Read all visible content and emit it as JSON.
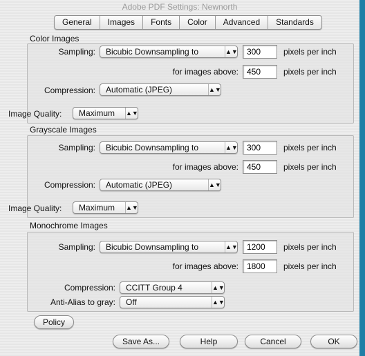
{
  "window": {
    "title": "Adobe PDF Settings: Newnorth"
  },
  "tabs": [
    "General",
    "Images",
    "Fonts",
    "Color",
    "Advanced",
    "Standards"
  ],
  "color": {
    "label": "Color Images",
    "sampling_label": "Sampling:",
    "sampling_value": "Bicubic Downsampling to",
    "resolution": "300",
    "resolution_unit": "pixels per inch",
    "above_label": "for images above:",
    "above_value": "450",
    "above_unit": "pixels per inch",
    "compression_label": "Compression:",
    "compression_value": "Automatic (JPEG)",
    "quality_label": "Image Quality:",
    "quality_value": "Maximum"
  },
  "grayscale": {
    "label": "Grayscale Images",
    "sampling_label": "Sampling:",
    "sampling_value": "Bicubic Downsampling to",
    "resolution": "300",
    "resolution_unit": "pixels per inch",
    "above_label": "for images above:",
    "above_value": "450",
    "above_unit": "pixels per inch",
    "compression_label": "Compression:",
    "compression_value": "Automatic (JPEG)",
    "quality_label": "Image Quality:",
    "quality_value": "Maximum"
  },
  "mono": {
    "label": "Monochrome Images",
    "sampling_label": "Sampling:",
    "sampling_value": "Bicubic Downsampling to",
    "resolution": "1200",
    "resolution_unit": "pixels per inch",
    "above_label": "for images above:",
    "above_value": "1800",
    "above_unit": "pixels per inch",
    "compression_label": "Compression:",
    "compression_value": "CCITT Group 4",
    "antialias_label": "Anti-Alias to gray:",
    "antialias_value": "Off"
  },
  "buttons": {
    "policy": "Policy",
    "save_as": "Save As...",
    "help": "Help",
    "cancel": "Cancel",
    "ok": "OK"
  },
  "icons": {
    "popup_arrow": "up-down-arrows-icon"
  },
  "colors": {
    "desktop": "#1f7fa6",
    "window_bg": "#eeeeee"
  }
}
